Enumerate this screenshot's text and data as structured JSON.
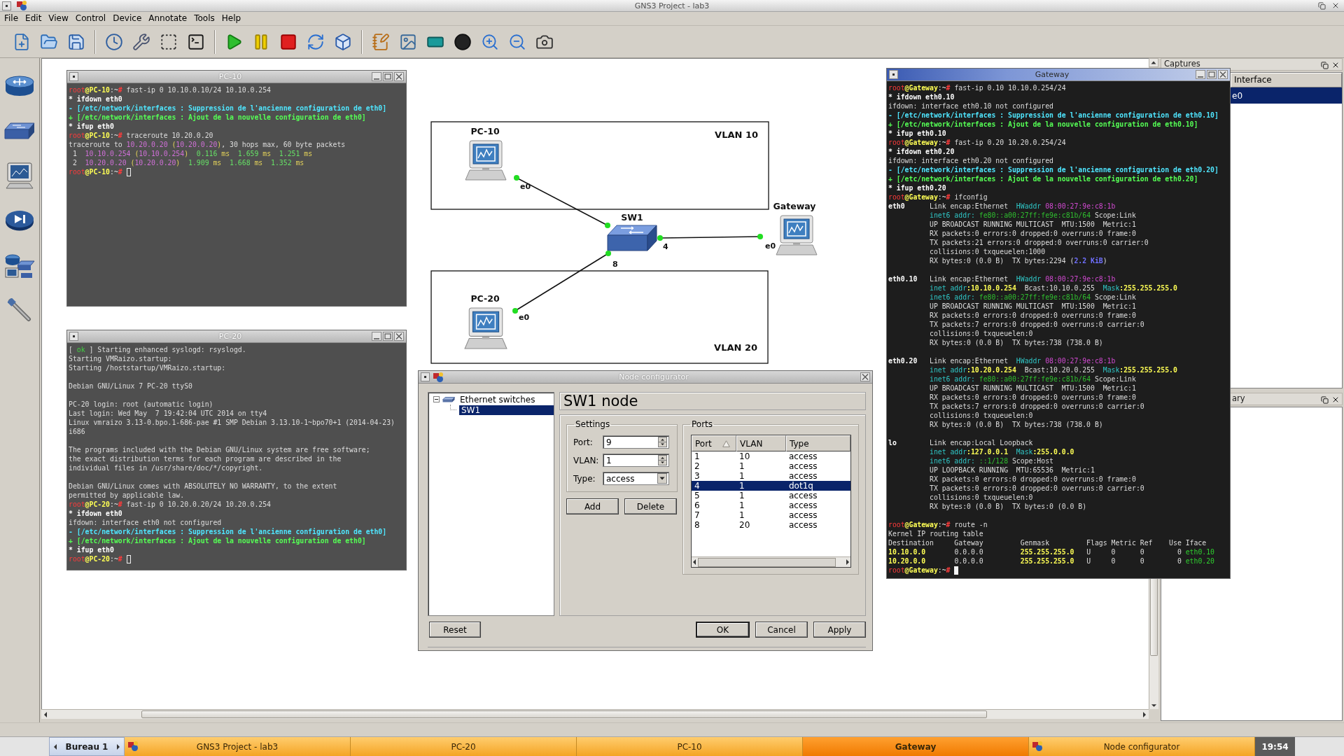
{
  "window": {
    "title": "GNS3 Project - lab3"
  },
  "menu": [
    "File",
    "Edit",
    "View",
    "Control",
    "Device",
    "Annotate",
    "Tools",
    "Help"
  ],
  "topology": {
    "vlans": [
      {
        "label": "VLAN 10"
      },
      {
        "label": "VLAN 20"
      }
    ],
    "nodes": [
      {
        "kind": "pc",
        "label": "PC-10"
      },
      {
        "kind": "switch",
        "label": "SW1"
      },
      {
        "kind": "pc",
        "label": "Gateway"
      },
      {
        "kind": "pc",
        "label": "PC-20"
      }
    ],
    "links": [
      {
        "up": true,
        "ports": [
          "e0"
        ]
      },
      {
        "up": true,
        "ports": [
          "4",
          "e0"
        ]
      },
      {
        "up": true,
        "ports": [
          "8",
          "e0"
        ]
      }
    ]
  },
  "terminals": [
    {
      "title": "PC-10",
      "focused": false,
      "lines": [
        {
          "kind": "text",
          "spans": [
            {
              "kind": "user",
              "text": "root"
            },
            {
              "kind": "host",
              "text": "@PC-10"
            },
            {
              "kind": "path",
              "text": ":~"
            },
            {
              "kind": "sign",
              "text": "# "
            },
            {
              "kind": "plain",
              "text": "fast-ip 0 10.10.0.10/24 10.10.0.254"
            }
          ]
        },
        {
          "kind": "text",
          "spans": [
            {
              "kind": "bold",
              "text": "* ifdown eth0"
            }
          ]
        },
        {
          "kind": "text",
          "spans": [
            {
              "kind": "info",
              "text": "- [/etc/network/interfaces : Suppression de l'ancienne configuration de eth0]"
            }
          ]
        },
        {
          "kind": "text",
          "spans": [
            {
              "kind": "ok",
              "text": "+ [/etc/network/interfaces : Ajout de la nouvelle configuration de eth0]"
            }
          ]
        },
        {
          "kind": "text",
          "spans": [
            {
              "kind": "bold",
              "text": "* ifup eth0"
            }
          ]
        },
        {
          "kind": "text",
          "spans": [
            {
              "kind": "user",
              "text": "root"
            },
            {
              "kind": "host",
              "text": "@PC-10"
            },
            {
              "kind": "path",
              "text": ":~"
            },
            {
              "kind": "sign",
              "text": "# "
            },
            {
              "kind": "plain",
              "text": "traceroute 10.20.0.20"
            }
          ]
        },
        {
          "kind": "text",
          "spans": [
            {
              "kind": "plain",
              "text": "traceroute to "
            },
            {
              "kind": "ip",
              "text": "10.20.0.20"
            },
            {
              "kind": "paren",
              "text": " ("
            },
            {
              "kind": "ip",
              "text": "10.20.0.20"
            },
            {
              "kind": "paren",
              "text": ")"
            },
            {
              "kind": "plain",
              "text": ", 30 hops max, 60 byte packets"
            }
          ]
        },
        {
          "kind": "text",
          "spans": [
            {
              "kind": "plain",
              "text": " 1  "
            },
            {
              "kind": "ip",
              "text": "10.10.0.254"
            },
            {
              "kind": "paren",
              "text": " ("
            },
            {
              "kind": "ip",
              "text": "10.10.0.254"
            },
            {
              "kind": "paren",
              "text": ")"
            },
            {
              "kind": "time",
              "text": "  0.116"
            },
            {
              "kind": "paren",
              "text": " ms"
            },
            {
              "kind": "time",
              "text": "  1.659"
            },
            {
              "kind": "paren",
              "text": " ms"
            },
            {
              "kind": "time",
              "text": "  1.251"
            },
            {
              "kind": "paren",
              "text": " ms"
            }
          ]
        },
        {
          "kind": "text",
          "spans": [
            {
              "kind": "plain",
              "text": " 2  "
            },
            {
              "kind": "ip",
              "text": "10.20.0.20"
            },
            {
              "kind": "paren",
              "text": " ("
            },
            {
              "kind": "ip",
              "text": "10.20.0.20"
            },
            {
              "kind": "paren",
              "text": ")"
            },
            {
              "kind": "time",
              "text": "  1.909"
            },
            {
              "kind": "paren",
              "text": " ms"
            },
            {
              "kind": "time",
              "text": "  1.668"
            },
            {
              "kind": "paren",
              "text": " ms"
            },
            {
              "kind": "time",
              "text": "  1.352"
            },
            {
              "kind": "paren",
              "text": " ms"
            }
          ]
        },
        {
          "kind": "input",
          "spans": [
            {
              "kind": "user",
              "text": "root"
            },
            {
              "kind": "host",
              "text": "@PC-10"
            },
            {
              "kind": "path",
              "text": ":~"
            },
            {
              "kind": "sign",
              "text": "# "
            }
          ]
        }
      ]
    },
    {
      "title": "PC-20",
      "focused": false,
      "lines": [
        {
          "kind": "text",
          "spans": [
            {
              "kind": "plain",
              "text": "[ "
            },
            {
              "kind": "good",
              "text": "ok"
            },
            {
              "kind": "plain",
              "text": " ] Starting enhanced syslogd: rsyslogd."
            }
          ]
        },
        {
          "kind": "text",
          "spans": [
            {
              "kind": "plain",
              "text": "Starting VMRaizo.startup:"
            }
          ]
        },
        {
          "kind": "text",
          "spans": [
            {
              "kind": "plain",
              "text": "Starting /hoststartup/VMRaizo.startup:"
            }
          ]
        },
        {
          "kind": "blank"
        },
        {
          "kind": "text",
          "spans": [
            {
              "kind": "plain",
              "text": "Debian GNU/Linux 7 PC-20 ttyS0"
            }
          ]
        },
        {
          "kind": "blank"
        },
        {
          "kind": "text",
          "spans": [
            {
              "kind": "plain",
              "text": "PC-20 login: root (automatic login)"
            }
          ]
        },
        {
          "kind": "text",
          "spans": [
            {
              "kind": "plain",
              "text": "Last login: Wed May  7 19:42:04 UTC 2014 on tty4"
            }
          ]
        },
        {
          "kind": "text",
          "spans": [
            {
              "kind": "plain",
              "text": "Linux vmraizo 3.13-0.bpo.1-686-pae #1 SMP Debian 3.13.10-1~bpo70+1 (2014-04-23)"
            }
          ]
        },
        {
          "kind": "text",
          "spans": [
            {
              "kind": "plain",
              "text": "i686"
            }
          ]
        },
        {
          "kind": "blank"
        },
        {
          "kind": "text",
          "spans": [
            {
              "kind": "plain",
              "text": "The programs included with the Debian GNU/Linux system are free software;"
            }
          ]
        },
        {
          "kind": "text",
          "spans": [
            {
              "kind": "plain",
              "text": "the exact distribution terms for each program are described in the"
            }
          ]
        },
        {
          "kind": "text",
          "spans": [
            {
              "kind": "plain",
              "text": "individual files in /usr/share/doc/*/copyright."
            }
          ]
        },
        {
          "kind": "blank"
        },
        {
          "kind": "text",
          "spans": [
            {
              "kind": "plain",
              "text": "Debian GNU/Linux comes with ABSOLUTELY NO WARRANTY, to the extent"
            }
          ]
        },
        {
          "kind": "text",
          "spans": [
            {
              "kind": "plain",
              "text": "permitted by applicable law."
            }
          ]
        },
        {
          "kind": "text",
          "spans": [
            {
              "kind": "user",
              "text": "root"
            },
            {
              "kind": "host",
              "text": "@PC-20"
            },
            {
              "kind": "path",
              "text": ":~"
            },
            {
              "kind": "sign",
              "text": "# "
            },
            {
              "kind": "plain",
              "text": "fast-ip 0 10.20.0.20/24 10.20.0.254"
            }
          ]
        },
        {
          "kind": "text",
          "spans": [
            {
              "kind": "bold",
              "text": "* ifdown eth0"
            }
          ]
        },
        {
          "kind": "text",
          "spans": [
            {
              "kind": "plain",
              "text": "ifdown: interface eth0 not configured"
            }
          ]
        },
        {
          "kind": "text",
          "spans": [
            {
              "kind": "info",
              "text": "- [/etc/network/interfaces : Suppression de l'ancienne configuration de eth0]"
            }
          ]
        },
        {
          "kind": "text",
          "spans": [
            {
              "kind": "ok",
              "text": "+ [/etc/network/interfaces : Ajout de la nouvelle configuration de eth0]"
            }
          ]
        },
        {
          "kind": "text",
          "spans": [
            {
              "kind": "bold",
              "text": "* ifup eth0"
            }
          ]
        },
        {
          "kind": "input",
          "spans": [
            {
              "kind": "user",
              "text": "root"
            },
            {
              "kind": "host",
              "text": "@PC-20"
            },
            {
              "kind": "path",
              "text": ":~"
            },
            {
              "kind": "sign",
              "text": "# "
            }
          ]
        }
      ]
    },
    {
      "title": "Gateway",
      "focused": true,
      "lines": [
        {
          "kind": "text",
          "spans": [
            {
              "kind": "user",
              "text": "root"
            },
            {
              "kind": "host",
              "text": "@Gateway"
            },
            {
              "kind": "path",
              "text": ":~"
            },
            {
              "kind": "sign",
              "text": "# "
            },
            {
              "kind": "plain",
              "text": "fast-ip 0.10 10.10.0.254/24"
            }
          ]
        },
        {
          "kind": "text",
          "spans": [
            {
              "kind": "bold",
              "text": "* ifdown eth0.10"
            }
          ]
        },
        {
          "kind": "text",
          "spans": [
            {
              "kind": "plain",
              "text": "ifdown: interface eth0.10 not configured"
            }
          ]
        },
        {
          "kind": "text",
          "spans": [
            {
              "kind": "info",
              "text": "- [/etc/network/interfaces : Suppression de l'ancienne configuration de eth0.10]"
            }
          ]
        },
        {
          "kind": "text",
          "spans": [
            {
              "kind": "ok",
              "text": "+ [/etc/network/interfaces : Ajout de la nouvelle configuration de eth0.10]"
            }
          ]
        },
        {
          "kind": "text",
          "spans": [
            {
              "kind": "bold",
              "text": "* ifup eth0.10"
            }
          ]
        },
        {
          "kind": "text",
          "spans": [
            {
              "kind": "user",
              "text": "root"
            },
            {
              "kind": "host",
              "text": "@Gateway"
            },
            {
              "kind": "path",
              "text": ":~"
            },
            {
              "kind": "sign",
              "text": "# "
            },
            {
              "kind": "plain",
              "text": "fast-ip 0.20 10.20.0.254/24"
            }
          ]
        },
        {
          "kind": "text",
          "spans": [
            {
              "kind": "bold",
              "text": "* ifdown eth0.20"
            }
          ]
        },
        {
          "kind": "text",
          "spans": [
            {
              "kind": "plain",
              "text": "ifdown: interface eth0.20 not configured"
            }
          ]
        },
        {
          "kind": "text",
          "spans": [
            {
              "kind": "info",
              "text": "- [/etc/network/interfaces : Suppression de l'ancienne configuration de eth0.20]"
            }
          ]
        },
        {
          "kind": "text",
          "spans": [
            {
              "kind": "ok",
              "text": "+ [/etc/network/interfaces : Ajout de la nouvelle configuration de eth0.20]"
            }
          ]
        },
        {
          "kind": "text",
          "spans": [
            {
              "kind": "bold",
              "text": "* ifup eth0.20"
            }
          ]
        },
        {
          "kind": "text",
          "spans": [
            {
              "kind": "user",
              "text": "root"
            },
            {
              "kind": "host",
              "text": "@Gateway"
            },
            {
              "kind": "path",
              "text": ":~"
            },
            {
              "kind": "sign",
              "text": "# "
            },
            {
              "kind": "plain",
              "text": "ifconfig"
            }
          ]
        },
        {
          "kind": "text",
          "spans": [
            {
              "kind": "bold",
              "text": "eth0"
            },
            {
              "kind": "plain",
              "text": "      Link encap:Ethernet  "
            },
            {
              "kind": "label",
              "text": "HWaddr"
            },
            {
              "kind": "mac",
              "text": " 08:00:27:9e:c8:1b"
            }
          ]
        },
        {
          "kind": "text",
          "spans": [
            {
              "kind": "label",
              "text": "          inet6 addr:"
            },
            {
              "kind": "ipv6",
              "text": " fe80::a00:27ff:fe9e:c81b/64"
            },
            {
              "kind": "plain",
              "text": " Scope:Link"
            }
          ]
        },
        {
          "kind": "text",
          "spans": [
            {
              "kind": "plain",
              "text": "          UP BROADCAST RUNNING MULTICAST  MTU:1500  Metric:1"
            }
          ]
        },
        {
          "kind": "text",
          "spans": [
            {
              "kind": "plain",
              "text": "          RX packets:0 errors:0 dropped:0 overruns:0 frame:0"
            }
          ]
        },
        {
          "kind": "text",
          "spans": [
            {
              "kind": "plain",
              "text": "          TX packets:21 errors:0 dropped:0 overruns:0 carrier:0"
            }
          ]
        },
        {
          "kind": "text",
          "spans": [
            {
              "kind": "plain",
              "text": "          collisions:0 txqueuelen:1000"
            }
          ]
        },
        {
          "kind": "text",
          "spans": [
            {
              "kind": "plain",
              "text": "          RX bytes:0 (0.0 B)  TX bytes:2294 ("
            },
            {
              "kind": "unit",
              "text": "2.2 KiB"
            },
            {
              "kind": "plain",
              "text": ")"
            }
          ]
        },
        {
          "kind": "blank"
        },
        {
          "kind": "text",
          "spans": [
            {
              "kind": "bold",
              "text": "eth0.10"
            },
            {
              "kind": "plain",
              "text": "   Link encap:Ethernet  "
            },
            {
              "kind": "label",
              "text": "HWaddr"
            },
            {
              "kind": "mac",
              "text": " 08:00:27:9e:c8:1b"
            }
          ]
        },
        {
          "kind": "text",
          "spans": [
            {
              "kind": "label",
              "text": "          inet addr"
            },
            {
              "kind": "value",
              "text": ":10.10.0.254"
            },
            {
              "kind": "plain",
              "text": "  Bcast:10.10.0.255  "
            },
            {
              "kind": "label",
              "text": "Mask"
            },
            {
              "kind": "value",
              "text": ":255.255.255.0"
            }
          ]
        },
        {
          "kind": "text",
          "spans": [
            {
              "kind": "label",
              "text": "          inet6 addr:"
            },
            {
              "kind": "ipv6",
              "text": " fe80::a00:27ff:fe9e:c81b/64"
            },
            {
              "kind": "plain",
              "text": " Scope:Link"
            }
          ]
        },
        {
          "kind": "text",
          "spans": [
            {
              "kind": "plain",
              "text": "          UP BROADCAST RUNNING MULTICAST  MTU:1500  Metric:1"
            }
          ]
        },
        {
          "kind": "text",
          "spans": [
            {
              "kind": "plain",
              "text": "          RX packets:0 errors:0 dropped:0 overruns:0 frame:0"
            }
          ]
        },
        {
          "kind": "text",
          "spans": [
            {
              "kind": "plain",
              "text": "          TX packets:7 errors:0 dropped:0 overruns:0 carrier:0"
            }
          ]
        },
        {
          "kind": "text",
          "spans": [
            {
              "kind": "plain",
              "text": "          collisions:0 txqueuelen:0"
            }
          ]
        },
        {
          "kind": "text",
          "spans": [
            {
              "kind": "plain",
              "text": "          RX bytes:0 (0.0 B)  TX bytes:738 (738.0 B)"
            }
          ]
        },
        {
          "kind": "blank"
        },
        {
          "kind": "text",
          "spans": [
            {
              "kind": "bold",
              "text": "eth0.20"
            },
            {
              "kind": "plain",
              "text": "   Link encap:Ethernet  "
            },
            {
              "kind": "label",
              "text": "HWaddr"
            },
            {
              "kind": "mac",
              "text": " 08:00:27:9e:c8:1b"
            }
          ]
        },
        {
          "kind": "text",
          "spans": [
            {
              "kind": "label",
              "text": "          inet addr"
            },
            {
              "kind": "value",
              "text": ":10.20.0.254"
            },
            {
              "kind": "plain",
              "text": "  Bcast:10.20.0.255  "
            },
            {
              "kind": "label",
              "text": "Mask"
            },
            {
              "kind": "value",
              "text": ":255.255.255.0"
            }
          ]
        },
        {
          "kind": "text",
          "spans": [
            {
              "kind": "label",
              "text": "          inet6 addr:"
            },
            {
              "kind": "ipv6",
              "text": " fe80::a00:27ff:fe9e:c81b/64"
            },
            {
              "kind": "plain",
              "text": " Scope:Link"
            }
          ]
        },
        {
          "kind": "text",
          "spans": [
            {
              "kind": "plain",
              "text": "          UP BROADCAST RUNNING MULTICAST  MTU:1500  Metric:1"
            }
          ]
        },
        {
          "kind": "text",
          "spans": [
            {
              "kind": "plain",
              "text": "          RX packets:0 errors:0 dropped:0 overruns:0 frame:0"
            }
          ]
        },
        {
          "kind": "text",
          "spans": [
            {
              "kind": "plain",
              "text": "          TX packets:7 errors:0 dropped:0 overruns:0 carrier:0"
            }
          ]
        },
        {
          "kind": "text",
          "spans": [
            {
              "kind": "plain",
              "text": "          collisions:0 txqueuelen:0"
            }
          ]
        },
        {
          "kind": "text",
          "spans": [
            {
              "kind": "plain",
              "text": "          RX bytes:0 (0.0 B)  TX bytes:738 (738.0 B)"
            }
          ]
        },
        {
          "kind": "blank"
        },
        {
          "kind": "text",
          "spans": [
            {
              "kind": "bold",
              "text": "lo"
            },
            {
              "kind": "plain",
              "text": "        Link encap:Local Loopback"
            }
          ]
        },
        {
          "kind": "text",
          "spans": [
            {
              "kind": "label",
              "text": "          inet addr"
            },
            {
              "kind": "value",
              "text": ":127.0.0.1"
            },
            {
              "kind": "label",
              "text": "  Mask"
            },
            {
              "kind": "value",
              "text": ":255.0.0.0"
            }
          ]
        },
        {
          "kind": "text",
          "spans": [
            {
              "kind": "label",
              "text": "          inet6 addr:"
            },
            {
              "kind": "ipv6",
              "text": " ::1/128"
            },
            {
              "kind": "plain",
              "text": " Scope:Host"
            }
          ]
        },
        {
          "kind": "text",
          "spans": [
            {
              "kind": "plain",
              "text": "          UP LOOPBACK RUNNING  MTU:65536  Metric:1"
            }
          ]
        },
        {
          "kind": "text",
          "spans": [
            {
              "kind": "plain",
              "text": "          RX packets:0 errors:0 dropped:0 overruns:0 frame:0"
            }
          ]
        },
        {
          "kind": "text",
          "spans": [
            {
              "kind": "plain",
              "text": "          TX packets:0 errors:0 dropped:0 overruns:0 carrier:0"
            }
          ]
        },
        {
          "kind": "text",
          "spans": [
            {
              "kind": "plain",
              "text": "          collisions:0 txqueuelen:0"
            }
          ]
        },
        {
          "kind": "text",
          "spans": [
            {
              "kind": "plain",
              "text": "          RX bytes:0 (0.0 B)  TX bytes:0 (0.0 B)"
            }
          ]
        },
        {
          "kind": "blank"
        },
        {
          "kind": "text",
          "spans": [
            {
              "kind": "user",
              "text": "root"
            },
            {
              "kind": "host",
              "text": "@Gateway"
            },
            {
              "kind": "path",
              "text": ":~"
            },
            {
              "kind": "sign",
              "text": "# "
            },
            {
              "kind": "plain",
              "text": "route -n"
            }
          ]
        },
        {
          "kind": "text",
          "spans": [
            {
              "kind": "plain",
              "text": "Kernel IP routing table"
            }
          ]
        },
        {
          "kind": "text",
          "spans": [
            {
              "kind": "plain",
              "text": "Destination     Gateway         Genmask         Flags Metric Ref    Use Iface"
            }
          ]
        },
        {
          "kind": "text",
          "spans": [
            {
              "kind": "value",
              "text": "10.10.0.0"
            },
            {
              "kind": "plain",
              "text": "       0.0.0.0         "
            },
            {
              "kind": "value",
              "text": "255.255.255.0"
            },
            {
              "kind": "plain",
              "text": "   U     0      0        0 "
            },
            {
              "kind": "iface",
              "text": "eth0.10"
            }
          ]
        },
        {
          "kind": "text",
          "spans": [
            {
              "kind": "value",
              "text": "10.20.0.0"
            },
            {
              "kind": "plain",
              "text": "       0.0.0.0         "
            },
            {
              "kind": "value",
              "text": "255.255.255.0"
            },
            {
              "kind": "plain",
              "text": "   U     0      0        0 "
            },
            {
              "kind": "iface",
              "text": "eth0.20"
            }
          ]
        },
        {
          "kind": "input",
          "spans": [
            {
              "kind": "user",
              "text": "root"
            },
            {
              "kind": "host",
              "text": "@Gateway"
            },
            {
              "kind": "path",
              "text": ":~"
            },
            {
              "kind": "sign",
              "text": "# "
            }
          ]
        }
      ]
    }
  ],
  "node_configurator": {
    "title": "Node configurator",
    "focused": false,
    "tree": [
      {
        "label": "Ethernet switches",
        "expanded": true,
        "selected": false,
        "children": [
          {
            "label": "SW1",
            "selected": true
          }
        ]
      }
    ],
    "heading": "SW1 node",
    "settings": {
      "title": "Settings",
      "fields": [
        {
          "kind": "spin",
          "label": "Port:",
          "value": "9"
        },
        {
          "kind": "spin",
          "label": "VLAN:",
          "value": "1"
        },
        {
          "kind": "combo",
          "label": "Type:",
          "value": "access"
        }
      ]
    },
    "actions": [
      "Add",
      "Delete"
    ],
    "ports": {
      "title": "Ports",
      "columns": [
        {
          "label": "Port",
          "sorted": true
        },
        {
          "label": "VLAN",
          "sorted": false
        },
        {
          "label": "Type",
          "sorted": false
        }
      ],
      "rows": [
        {
          "cells": [
            "1",
            "10",
            "access"
          ],
          "selected": false
        },
        {
          "cells": [
            "2",
            "1",
            "access"
          ],
          "selected": false
        },
        {
          "cells": [
            "3",
            "1",
            "access"
          ],
          "selected": false
        },
        {
          "cells": [
            "4",
            "1",
            "dot1q"
          ],
          "selected": true
        },
        {
          "cells": [
            "5",
            "1",
            "access"
          ],
          "selected": false
        },
        {
          "cells": [
            "6",
            "1",
            "access"
          ],
          "selected": false
        },
        {
          "cells": [
            "7",
            "1",
            "access"
          ],
          "selected": false
        },
        {
          "cells": [
            "8",
            "20",
            "access"
          ],
          "selected": false
        }
      ]
    },
    "reset": "Reset",
    "buttons": [
      {
        "label": "OK",
        "default": true
      },
      {
        "label": "Cancel",
        "default": false
      },
      {
        "label": "Apply",
        "default": false
      }
    ]
  },
  "captures": {
    "title": "Captures",
    "columns": [
      "Interface"
    ],
    "rows": [
      {
        "cells": [
          "e0"
        ],
        "selected": true
      }
    ]
  },
  "topology_summary": {
    "title": "ary"
  },
  "taskbar": {
    "desktop": "Bureau 1",
    "items": [
      {
        "label": "GNS3 Project - lab3",
        "icon": true,
        "selected": false
      },
      {
        "label": "PC-20",
        "icon": false,
        "selected": false
      },
      {
        "label": "PC-10",
        "icon": false,
        "selected": false
      },
      {
        "label": "Gateway",
        "icon": false,
        "selected": true
      },
      {
        "label": "Node configurator",
        "icon": true,
        "selected": false
      }
    ],
    "clock": "19:54"
  }
}
